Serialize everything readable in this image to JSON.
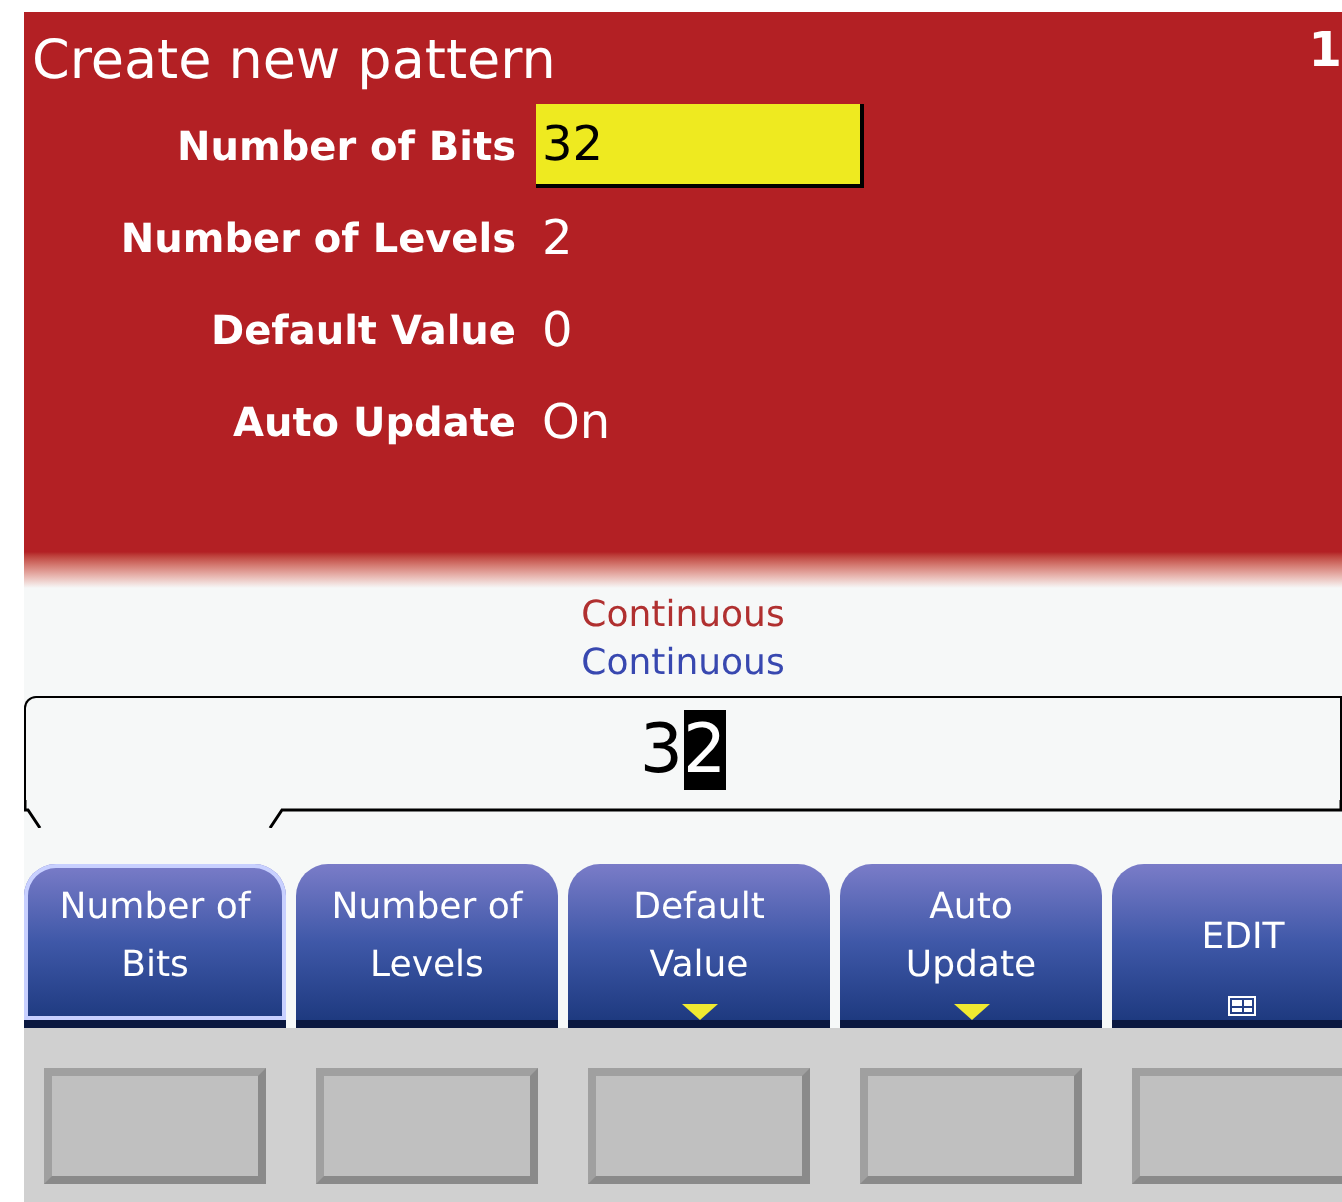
{
  "title": "Create new pattern",
  "corner_text": "1",
  "fields": [
    {
      "label": "Number of Bits",
      "value": "32",
      "selected": true
    },
    {
      "label": "Number of Levels",
      "value": "2",
      "selected": false
    },
    {
      "label": "Default Value",
      "value": "0",
      "selected": false
    },
    {
      "label": "Auto Update",
      "value": "On",
      "selected": false
    }
  ],
  "status_lines": [
    {
      "text": "Continuous",
      "color": "#b03030"
    },
    {
      "text": "Continuous",
      "color": "#3848b0"
    }
  ],
  "entry": {
    "digits": [
      {
        "char": "3",
        "cursor": false
      },
      {
        "char": "2",
        "cursor": true
      }
    ]
  },
  "softkeys": [
    {
      "lines": [
        "Number of",
        "Bits"
      ],
      "kind": "value",
      "submenu": false,
      "selected": true
    },
    {
      "lines": [
        "Number of",
        "Levels"
      ],
      "kind": "value",
      "submenu": false,
      "selected": false
    },
    {
      "lines": [
        "Default",
        "Value"
      ],
      "kind": "value",
      "submenu": true,
      "selected": false
    },
    {
      "lines": [
        "Auto",
        "Update"
      ],
      "kind": "value",
      "submenu": true,
      "selected": false
    },
    {
      "lines": [
        "EDIT"
      ],
      "kind": "edit",
      "submenu": false,
      "selected": false
    }
  ]
}
